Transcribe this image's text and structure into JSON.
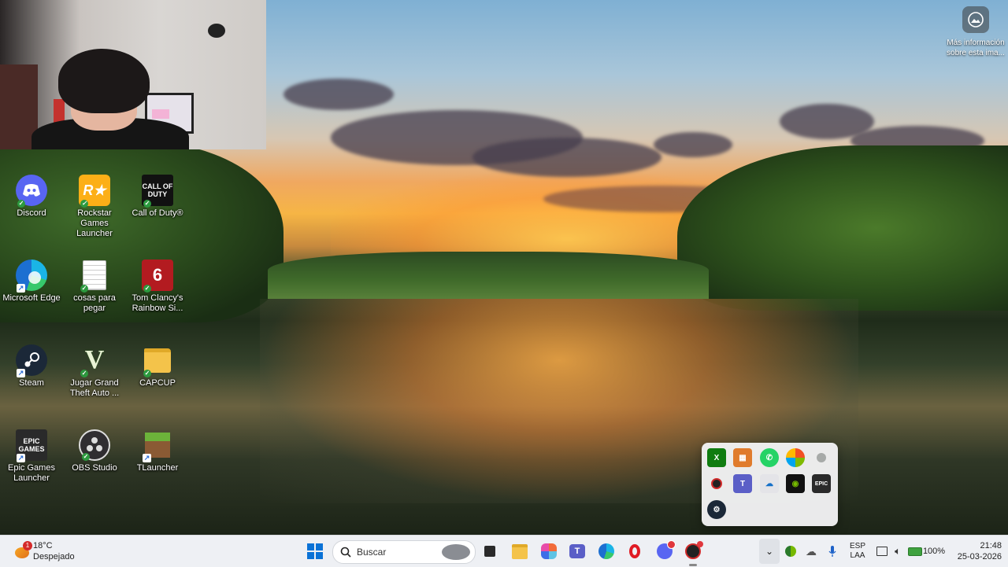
{
  "desktop": {
    "icons": [
      {
        "label": "Discord"
      },
      {
        "label": "Rockstar Games Launcher"
      },
      {
        "label": "Call of Duty®"
      },
      {
        "label": "Microsoft Edge"
      },
      {
        "label": "cosas para pegar"
      },
      {
        "label": "Tom Clancy's Rainbow Si..."
      },
      {
        "label": "Steam"
      },
      {
        "label": "Jugar Grand Theft Auto ..."
      },
      {
        "label": "CAPCUP"
      },
      {
        "label": "Epic Games Launcher"
      },
      {
        "label": "OBS Studio"
      },
      {
        "label": "TLauncher"
      }
    ],
    "icon_glyphs": {
      "rockstar": "R★",
      "cod": "CALL OF DUTY",
      "rainbow": "6",
      "gta": "V",
      "epic": "EPIC GAMES"
    },
    "info_text": "Más información sobre esta ima..."
  },
  "tray_popup": {
    "icons": [
      "xbox-icon",
      "app-orange-icon",
      "whatsapp-icon",
      "copilot-icon",
      "circle-gray-icon",
      "red-app-icon",
      "teams-icon",
      "onedrive-warning-icon",
      "nvidia-icon",
      "epic-games-icon",
      "steam-icon"
    ],
    "epic_glyph": "EPIC"
  },
  "taskbar": {
    "weather": {
      "badge": "1",
      "temp": "18°C",
      "desc": "Despejado"
    },
    "search_placeholder": "Buscar",
    "language": {
      "line1": "ESP",
      "line2": "LAA"
    },
    "battery": "100%",
    "time": "21:48",
    "date": "25-03-2026"
  },
  "colors": {
    "taskbar_bg": "#eef0f4",
    "discord": "#5865f2",
    "rockstar": "#fcaf17",
    "edge": "#1c8ede",
    "opera": "#e01b24"
  }
}
